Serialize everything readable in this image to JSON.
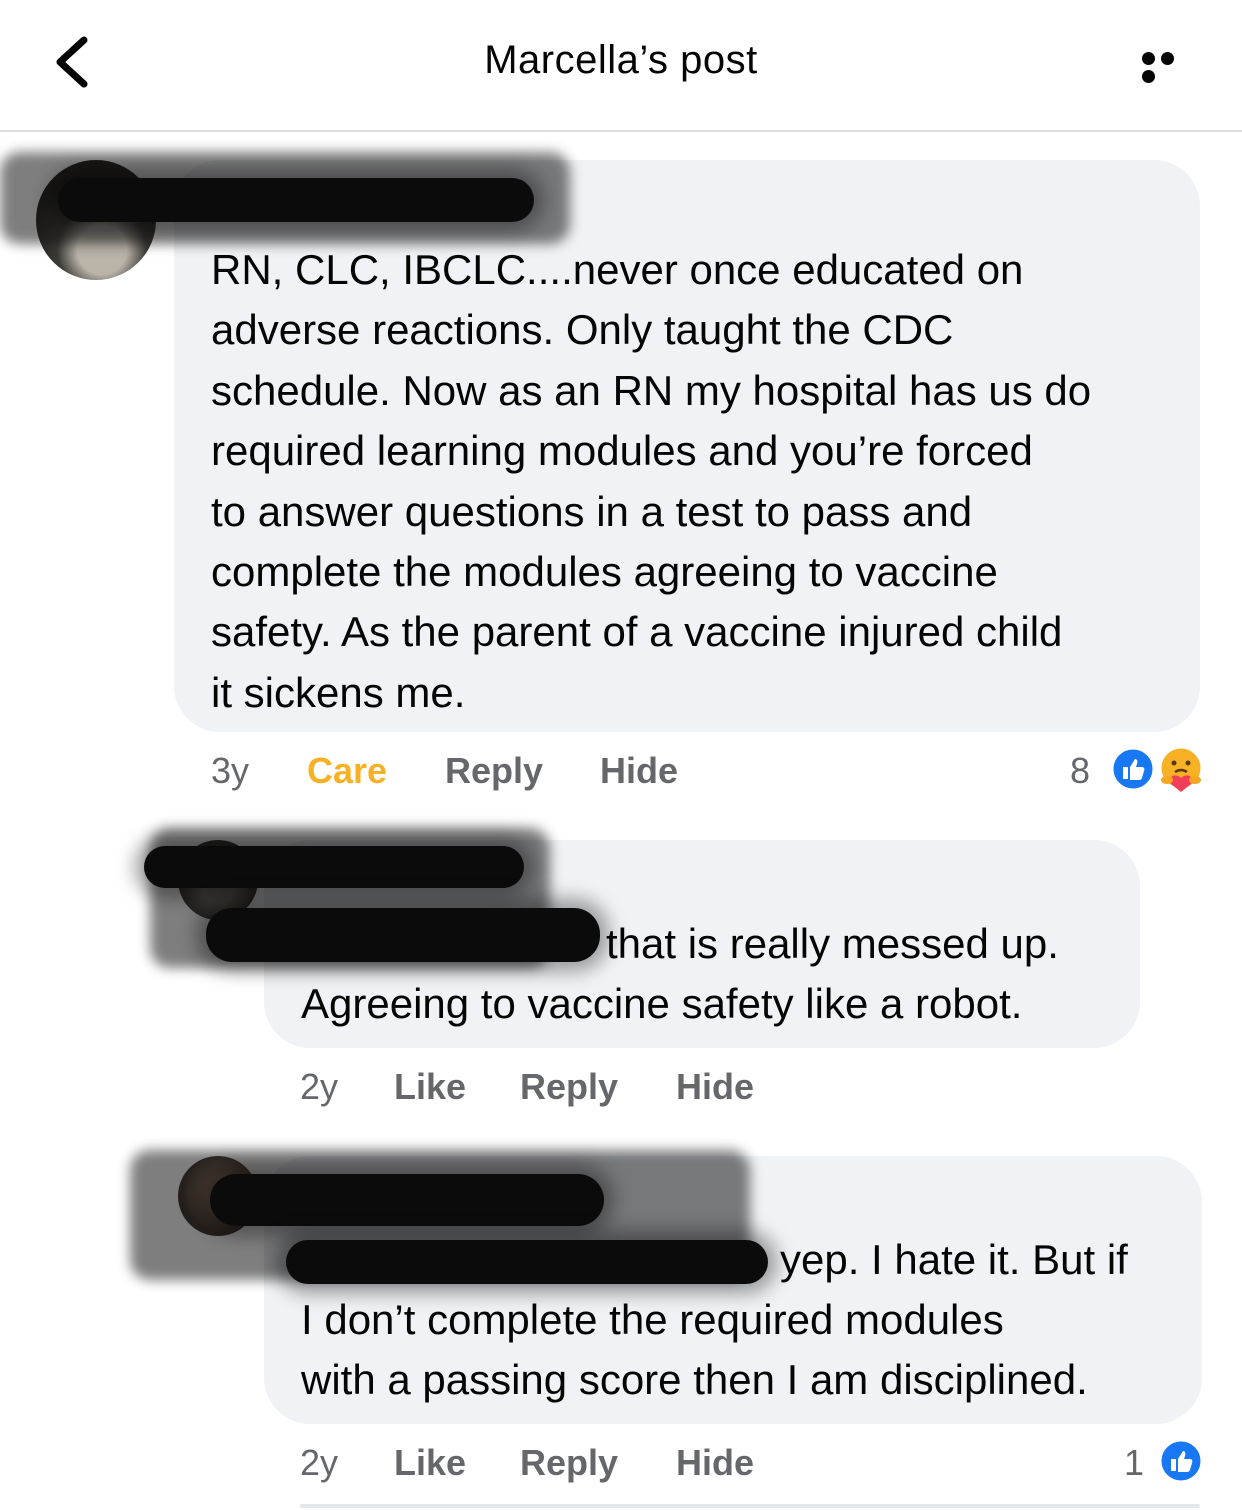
{
  "header": {
    "title": "Marcella’s post"
  },
  "comments": [
    {
      "text_lines": [
        "RN, CLC, IBCLC....never once educated on",
        "adverse reactions. Only taught the CDC",
        "schedule. Now as an RN my hospital has us do",
        "required learning modules and you’re forced",
        "to answer questions in a test to pass and",
        "complete the modules agreeing to vaccine",
        "safety. As the parent of a vaccine injured child",
        "it sickens me."
      ],
      "time": "3y",
      "reaction_label": "Care",
      "reply_label": "Reply",
      "hide_label": "Hide",
      "reaction_count": "8",
      "reactions": [
        "like-icon",
        "care-icon"
      ]
    },
    {
      "text_lines": [
        "that is really messed up.",
        "Agreeing to vaccine safety like a robot."
      ],
      "time": "2y",
      "reaction_label": "Like",
      "reply_label": "Reply",
      "hide_label": "Hide"
    },
    {
      "text_lines": [
        "yep. I hate it. But if",
        "I don’t complete the required modules",
        "with a passing score then I am disciplined."
      ],
      "time": "2y",
      "reaction_label": "Like",
      "reply_label": "Reply",
      "hide_label": "Hide",
      "reaction_count": "1",
      "reactions": [
        "like-icon"
      ]
    }
  ],
  "colors": {
    "bubble": "#f0f2f5",
    "secondary_text": "#65676b",
    "care_reaction": "#f7b125",
    "like_blue": "#1877f2"
  }
}
